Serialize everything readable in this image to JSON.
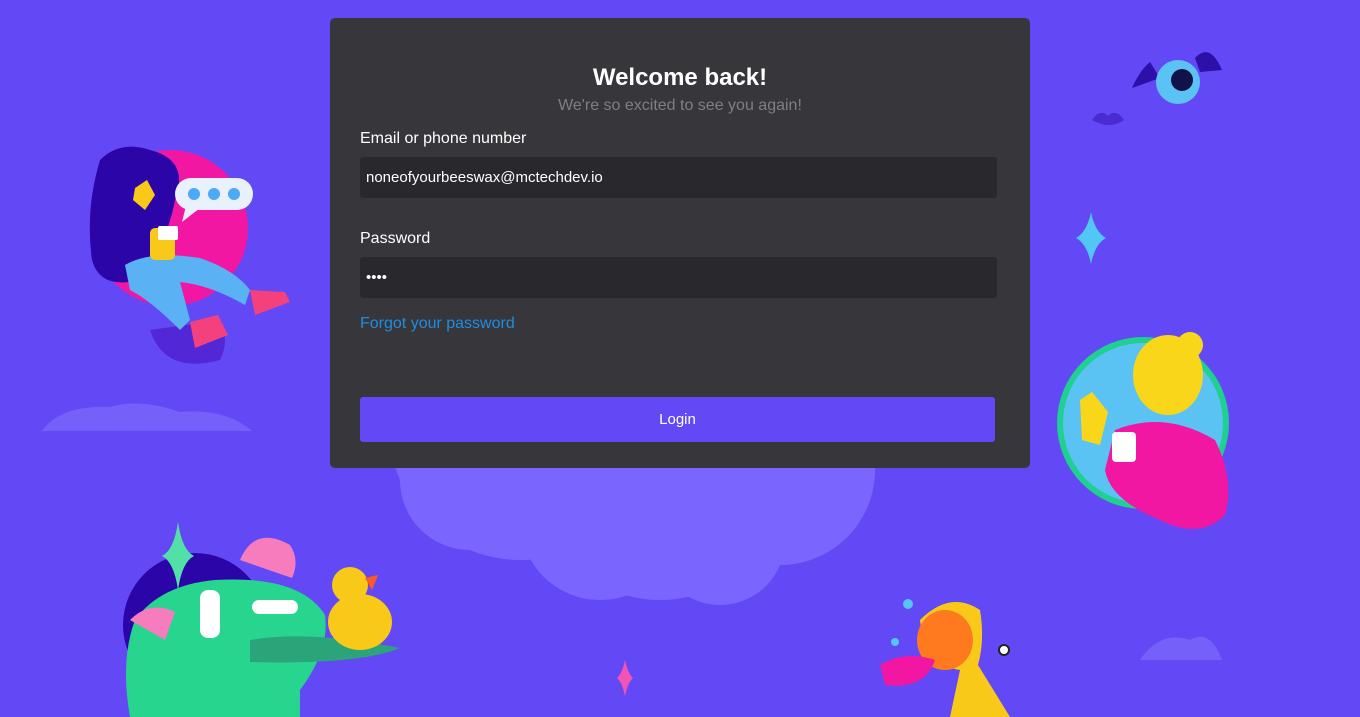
{
  "login": {
    "title": "Welcome back!",
    "subtitle": "We're so excited to see you again!",
    "email_label": "Email or phone number",
    "email_value": "noneofyourbeeswax@mctechdev.io",
    "password_label": "Password",
    "password_value": "••••",
    "forgot_link": "Forgot your password",
    "login_button": "Login"
  },
  "colors": {
    "background": "#6349f5",
    "card": "#36363b",
    "input": "#28282d",
    "link": "#1f8ee2",
    "button": "#6349f5"
  },
  "illustrations": [
    "girl-with-phone-illustration",
    "chat-bubble-icon",
    "bat-icon",
    "sparkle-icon",
    "waving-character-illustration",
    "dinosaur-with-headphones-illustration",
    "duck-illustration",
    "trumpet-creature-illustration",
    "cloud-decoration"
  ]
}
